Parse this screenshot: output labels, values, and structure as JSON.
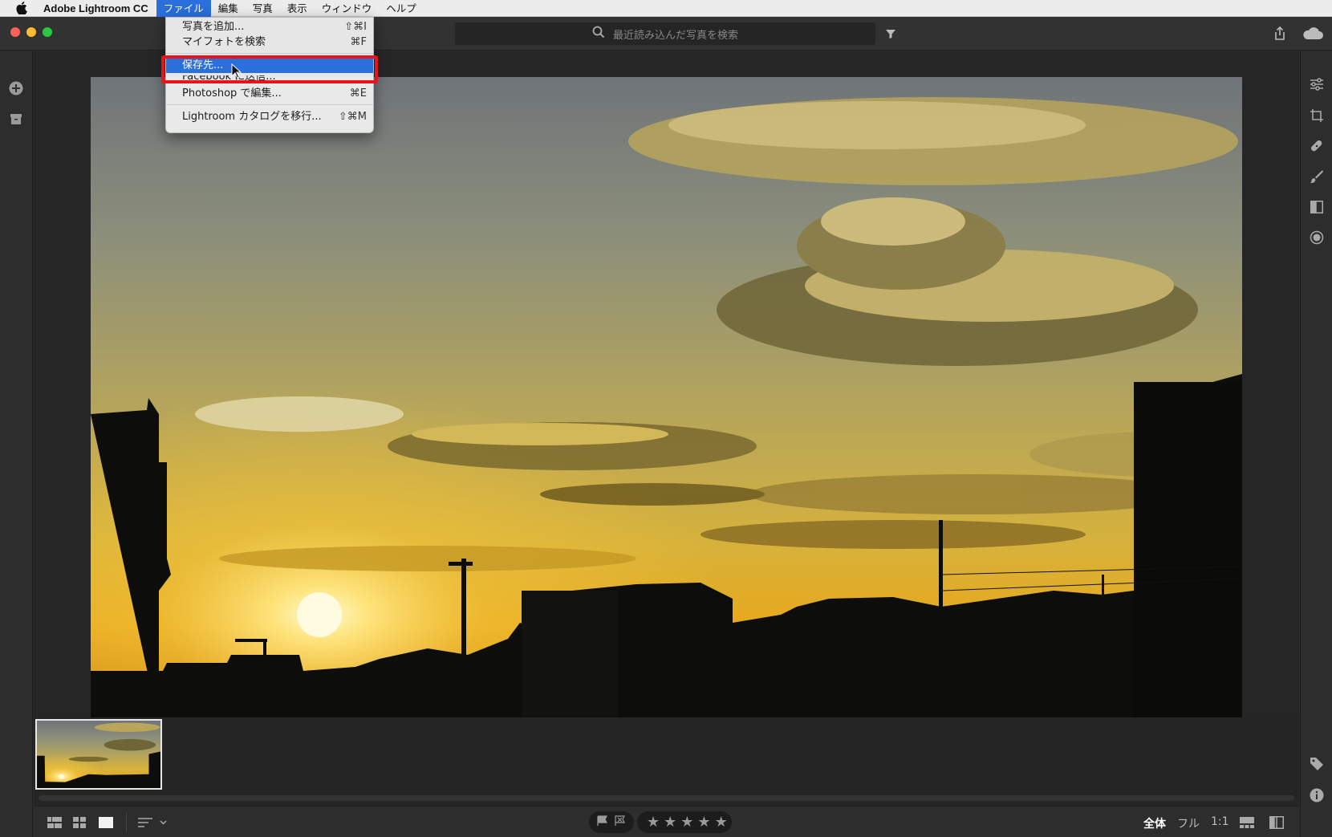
{
  "menubar": {
    "app_name": "Adobe Lightroom CC",
    "menus": [
      "ファイル",
      "編集",
      "写真",
      "表示",
      "ウィンドウ",
      "ヘルプ"
    ]
  },
  "titlebar": {
    "search_placeholder": "最近読み込んだ写真を検索"
  },
  "file_menu": {
    "items": [
      {
        "label": "写真を追加...",
        "shortcut": "⇧⌘I"
      },
      {
        "label": "マイフォトを検索",
        "shortcut": "⌘F"
      },
      {
        "label": "保存先...",
        "shortcut": ""
      },
      {
        "label": "Facebook に送信...",
        "shortcut": ""
      },
      {
        "label": "Photoshop で編集...",
        "shortcut": "⌘E"
      },
      {
        "label": "Lightroom カタログを移行...",
        "shortcut": "⇧⌘M"
      }
    ],
    "selected": "保存先..."
  },
  "bottombar": {
    "stars": [
      "★",
      "★",
      "★",
      "★",
      "★"
    ],
    "zoom_options": [
      "全体",
      "フル",
      "1:1"
    ]
  },
  "colors": {
    "accent": "#2a6fdb",
    "highlight_box": "#e8141b",
    "sky_gold": "#e9c14a",
    "sun": "#fff2a8"
  },
  "icons": {
    "left_toolbar": [
      "add-photos-icon",
      "archive-icon"
    ],
    "right_toolbar": [
      "edit-sliders-icon",
      "crop-icon",
      "healing-icon",
      "brush-icon",
      "linear-gradient-icon",
      "radial-gradient-icon",
      "tag-icon",
      "info-icon"
    ],
    "bottom_left": [
      "square-grid-icon",
      "photo-grid-icon",
      "detail-view-icon",
      "sort-icon"
    ],
    "bottom_right": [
      "filmstrip-toggle-icon",
      "compare-icon"
    ]
  }
}
